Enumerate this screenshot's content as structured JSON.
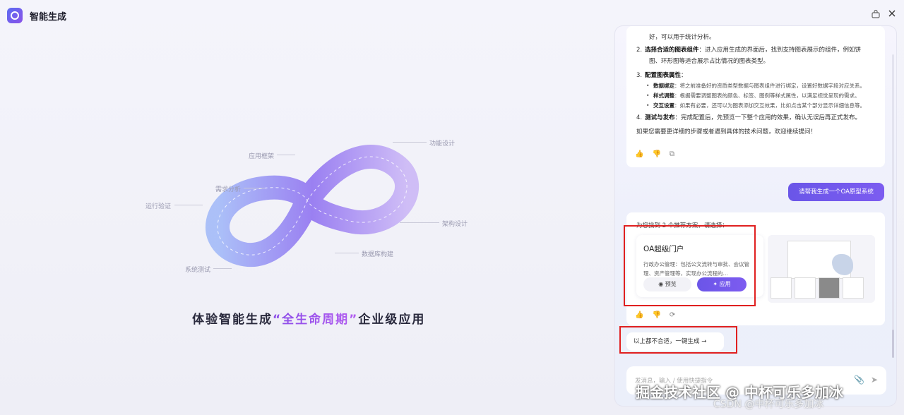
{
  "app": {
    "title": "智能生成"
  },
  "hero": {
    "nodes": [
      "应用框架",
      "功能设计",
      "需求分析",
      "运行验证",
      "架构设计",
      "数据库构建",
      "系统测试"
    ],
    "tagline_pre": "体验智能生成",
    "tagline_highlight": "“全生命周期”",
    "tagline_post": "企业级应用"
  },
  "chat": {
    "ai_message_1": {
      "line_top": "好，可以用于统计分析。",
      "step2_title": "选择合适的图表组件",
      "step2_text": "：进入应用生成的界面后，找到支持图表展示的组件，例如饼",
      "step2_text2": "图、环形图等适合展示占比情况的图表类型。",
      "step3_title": "配置图表属性",
      "step3_colon": "：",
      "sub1_title": "数据绑定",
      "sub1_text": "：将之前准备好的资质类型数据与图表组件进行绑定，设置好数据字段对应关系。",
      "sub2_title": "样式调整",
      "sub2_text": "：根据需要调整图表的颜色、标签、图例等样式属性，以满足视觉呈现的需求。",
      "sub3_title": "交互设置",
      "sub3_text": "：如果有必要，还可以为图表添加交互效果，比如点击某个部分显示详细信息等。",
      "step4_title": "测试与发布",
      "step4_text": "：完成配置后，先预览一下整个应用的效果，确认无误后再正式发布。",
      "closing": "如果您需要更详细的步骤或者遇到具体的技术问题，欢迎继续提问！",
      "n2": "2.",
      "n3": "3.",
      "n4": "4."
    },
    "user_message": "请帮我生成一个OA原型系统",
    "ai_message_2": {
      "intro": "为您找到 2 个推荐方案，请选择：",
      "plan_title": "OA超级门户",
      "plan_desc": "行政办公管理：包括公文流转与审批、会议管理、资产管理等，实现办公流程的…",
      "preview_label": "预览",
      "apply_label": "应用"
    },
    "fallback_button": "以上都不合适，一键生成",
    "input_placeholder": "发消息，输入 / 使用快捷指令"
  },
  "watermark": {
    "main": "掘金技术社区 @ 中杯可乐多加冰",
    "sub": "CSDN @中杯可乐多加冰"
  },
  "colors": {
    "accent": "#6b55e8",
    "highlight": "#e02020"
  }
}
